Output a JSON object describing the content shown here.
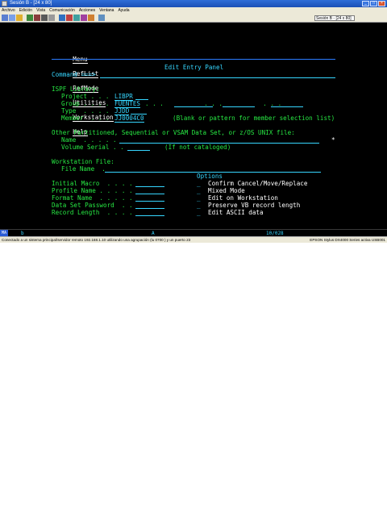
{
  "window": {
    "title": "Sesión B - [24 x 80]",
    "session_box": "Sesión B - [24 x 80]"
  },
  "menubar": [
    "Archivo",
    "Edición",
    "Vista",
    "Comunicación",
    "Acciones",
    "Ventana",
    "Ayuda"
  ],
  "pmenu": [
    "Menu",
    "RefList",
    "RefMode",
    "Utilities",
    "Workstation",
    "Help"
  ],
  "screen": {
    "panel_title": "Edit Entry Panel",
    "command_label": "Command ===>",
    "ispf_library_heading": "ISPF Library:",
    "project_label": "Project . . .",
    "project_value": "LIBPR",
    "group_label": "Group . . . .",
    "group_value": "FUENTES",
    "group_extra": ". . .           . . .           . . .",
    "type_label": "Type  . . . .",
    "type_value": "JJDD",
    "member_label": "Member  . . .",
    "member_value": "JJ0004C0",
    "member_hint": "(Blank or pattern for member selection list)",
    "other_heading": "Other Partitioned, Sequential or VSAM Data Set, or z/OS UNIX file:",
    "name_label": "Name  . . . . .",
    "volume_label": "Volume Serial . .",
    "volume_hint": "(If not cataloged)",
    "workstation_heading": "Workstation File:",
    "file_name_label": "File Name  .",
    "options_heading": "Options",
    "fields": [
      "Initial Macro  . . . .",
      "Profile Name . . . . .",
      "Format Name  . . . . .",
      "Data Set Password  . .",
      "Record Length  . . . ."
    ],
    "options": [
      "Confirm Cancel/Move/Replace",
      "Mixed Mode",
      "Edit on Workstation",
      "Preserve VB record length",
      "Edit ASCII data"
    ],
    "option_mark": "_",
    "star": "*"
  },
  "status": {
    "mode": "MA",
    "letter": "b",
    "indicator": "A",
    "cursor_pos": "10/028"
  },
  "osbar": {
    "left": "Conectado a un sistema principal/servidor remoto 192.168.1.10 utilizando una agrupación (lu 0700 ) y un puerto 23",
    "right": "EPSON Stylus DX4000 Series activa USB001"
  },
  "colors": {
    "background": "#000000",
    "text_cyan": "#36d6ff",
    "text_green": "#27e843",
    "text_white": "#ffffff"
  }
}
